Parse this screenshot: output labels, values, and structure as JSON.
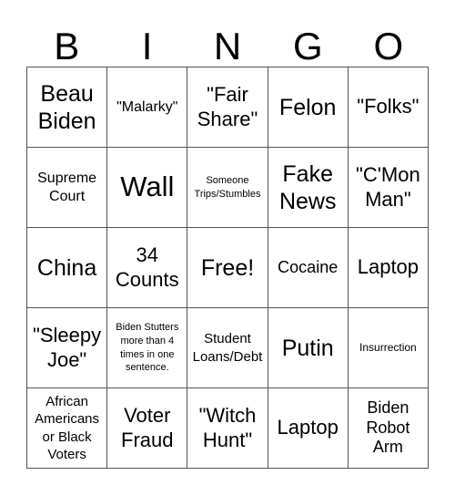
{
  "header": {
    "letters": [
      "B",
      "I",
      "N",
      "G",
      "O"
    ]
  },
  "cells": [
    "Beau Biden",
    "\"Malarky\"",
    "\"Fair Share\"",
    "Felon",
    "\"Folks\"",
    "Supreme Court",
    "Wall",
    "Someone Trips/Stumbles",
    "Fake News",
    "\"C'Mon Man\"",
    "China",
    "34 Counts",
    "Free!",
    "Cocaine",
    "Laptop",
    "\"Sleepy Joe\"",
    "Biden Stutters more than 4 times in one sentence.",
    "Student Loans/Debt",
    "Putin",
    "Insurrection",
    "African Americans or Black Voters",
    "Voter Fraud",
    "\"Witch Hunt\"",
    "Laptop",
    "Biden Robot Arm"
  ]
}
